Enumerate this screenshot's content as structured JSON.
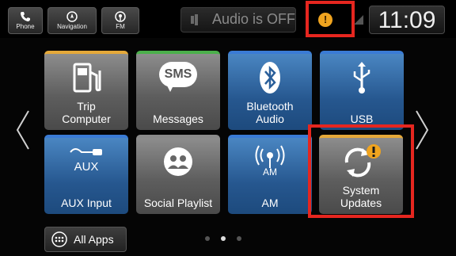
{
  "topbar": {
    "phone_label": "Phone",
    "navigation_label": "Navigation",
    "fm_label": "FM",
    "audio_status": "Audio is OFF",
    "notification_count": "!",
    "clock": "11:09"
  },
  "tiles": [
    {
      "label": "Trip\nComputer",
      "icon": "fuel-pump-icon",
      "accent": "#e5a93a"
    },
    {
      "label": "Messages",
      "icon": "sms-icon",
      "accent": "#4bb04b"
    },
    {
      "label": "Bluetooth\nAudio",
      "icon": "bluetooth-icon",
      "accent": "#3a7bd5"
    },
    {
      "label": "USB",
      "icon": "usb-icon",
      "accent": "#3a7bd5"
    },
    {
      "label": "AUX Input",
      "icon": "aux-icon",
      "aux_text": "AUX",
      "accent": "#3a7bd5"
    },
    {
      "label": "Social Playlist",
      "icon": "social-playlist-icon",
      "accent": "#8a8a8a"
    },
    {
      "label": "AM",
      "icon": "am-antenna-icon",
      "am_text": "AM",
      "accent": "#3a7bd5"
    },
    {
      "label": "System\nUpdates",
      "icon": "system-update-icon",
      "accent": "#e5a93a"
    }
  ],
  "sms_text": "SMS",
  "pager": {
    "pages": 3,
    "active": 2
  },
  "all_apps_label": "All Apps",
  "colors": {
    "highlight": "#e6261f",
    "warning": "#f0a41f"
  }
}
